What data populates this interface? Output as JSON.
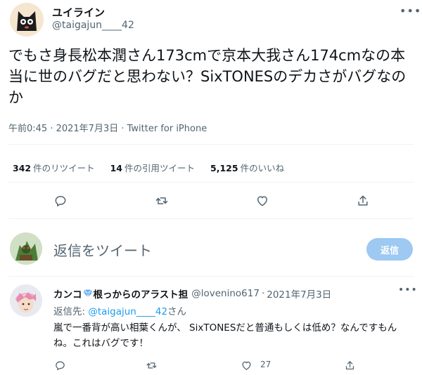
{
  "tweet": {
    "author_name": "ユイライン",
    "author_handle": "@taigajun____42",
    "more_icon": "more-horizontal-icon",
    "text": "でもさ身長松本潤さん173cmで京本大我さん174cmなの本当に世のバグだと思わない？SixTONESのデカさがバグなのか",
    "meta": "午前0:45 · 2021年7月3日 · Twitter for iPhone",
    "stats": {
      "retweets_count": "342",
      "retweets_label": "件のリツイート",
      "quotes_count": "14",
      "quotes_label": "件の引用ツイート",
      "likes_count": "5,125",
      "likes_label": "件のいいね"
    },
    "actions": [
      "reply-icon",
      "retweet-icon",
      "like-icon",
      "share-icon"
    ]
  },
  "composer": {
    "placeholder": "返信をツイート",
    "button_label": "返信"
  },
  "reply": {
    "author_name_before": "カンコ",
    "author_name_after": "根っからのアラスト担",
    "author_handle": "@lovenino617",
    "separator": "·",
    "date": "2021年7月3日",
    "replying_to_prefix": "返信先: ",
    "replying_to_handle": "@taigajun____42",
    "replying_to_suffix": "さん",
    "text": "嵐で一番背が高い相葉くんが、 SixTONESだと普通もしくは低め？なんですもんね。これはバグです！",
    "like_count": "27"
  },
  "colors": {
    "accent": "#1d9bf0",
    "button_disabled": "#9dc9f2",
    "secondary_text": "#536471",
    "divider": "#eff3f4"
  }
}
